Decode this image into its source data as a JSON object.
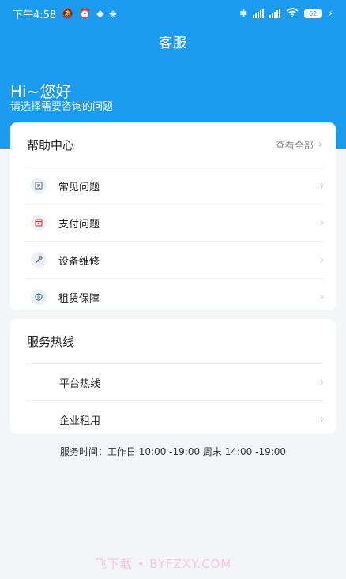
{
  "status_bar": {
    "time": "下午4:58",
    "battery": "62"
  },
  "header": {
    "title": "客服",
    "greeting": "Hi~您好",
    "subtitle": "请选择需要咨询的问题"
  },
  "help_center": {
    "title": "帮助中心",
    "view_all": "查看全部",
    "items": [
      {
        "label": "常见问题",
        "icon": "document-icon"
      },
      {
        "label": "支付问题",
        "icon": "payment-icon"
      },
      {
        "label": "设备维修",
        "icon": "wrench-icon"
      },
      {
        "label": "租赁保障",
        "icon": "shield-icon"
      }
    ]
  },
  "hotline": {
    "title": "服务热线",
    "items": [
      {
        "label": "平台热线"
      },
      {
        "label": "企业租用"
      }
    ]
  },
  "service_time": "服务时间：工作日 10:00 -19:00 周末 14:00 -19:00",
  "watermark": "飞下载 • BYFZXY.COM",
  "colors": {
    "primary": "#1a9bf0",
    "background": "#f4f5f7"
  }
}
